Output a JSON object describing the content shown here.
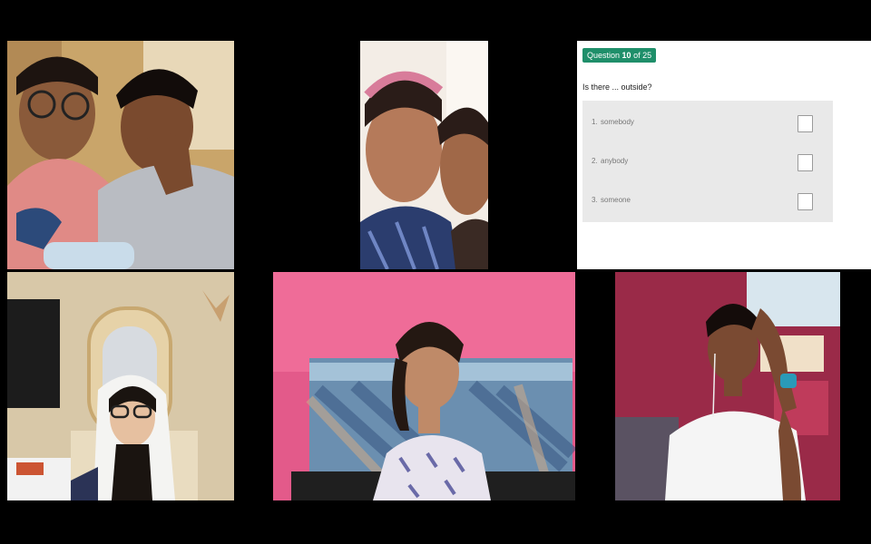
{
  "quiz": {
    "badge_prefix": "Question",
    "current": "10",
    "badge_of": "of",
    "total": "25",
    "question": "Is there ... outside?",
    "options": [
      {
        "num": "1.",
        "text": "somebody",
        "checked": false
      },
      {
        "num": "2.",
        "text": "anybody",
        "checked": false
      },
      {
        "num": "3.",
        "text": "someone",
        "checked": true
      }
    ],
    "accent_color": "#1f8f6a"
  },
  "participants": [
    {
      "tile": "tile-1"
    },
    {
      "tile": "tile-2"
    },
    {
      "tile": "tile-4"
    },
    {
      "tile": "tile-5"
    },
    {
      "tile": "tile-6"
    }
  ]
}
